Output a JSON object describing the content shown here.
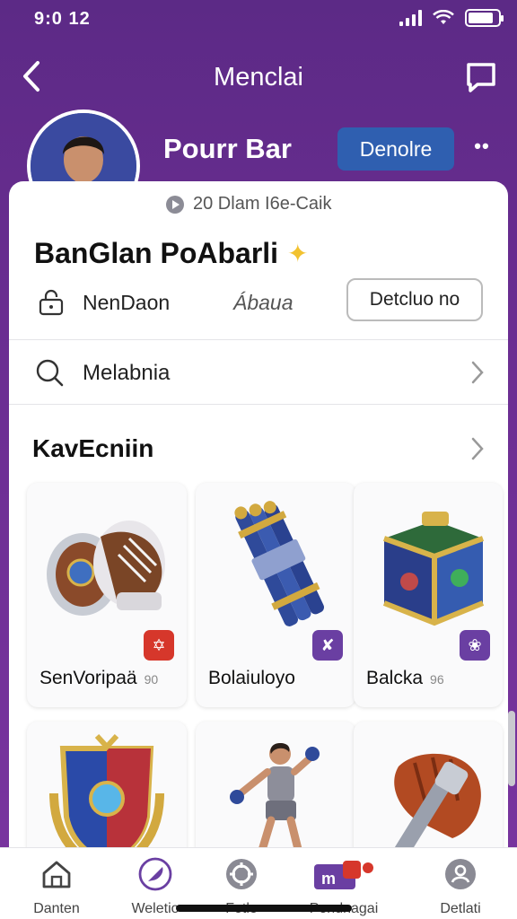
{
  "status_bar": {
    "time": "9:0 12"
  },
  "header": {
    "title": "Menclai"
  },
  "profile": {
    "name": "Pourr Bar",
    "primary_button": "Denolre",
    "meta": "20 Dlam I6e-Caik",
    "title": "BanGlan PoAbarli",
    "action_1": "NenDaon",
    "action_2": "Ábaua",
    "secondary_button": "Detcluo no"
  },
  "search": {
    "label": "Melabnia"
  },
  "section": {
    "title": "KavEcniin"
  },
  "items": [
    {
      "name": "SenVoripaä",
      "count": "90",
      "badge": "✡",
      "badge_color": "#d6372b",
      "icon": "gauntlets-icon"
    },
    {
      "name": "Bolaiuloyo",
      "count": "",
      "badge": "✘",
      "badge_color": "#6a3fa2",
      "icon": "rockets-bundle-icon"
    },
    {
      "name": "Balcka",
      "count": "96",
      "badge": "❀",
      "badge_color": "#6a3fa2",
      "icon": "treasure-chest-icon"
    },
    {
      "name": "",
      "count": "",
      "badge": "",
      "badge_color": "",
      "icon": "crest-shield-icon"
    },
    {
      "name": "",
      "count": "",
      "badge": "",
      "badge_color": "",
      "icon": "fighter-figure-icon"
    },
    {
      "name": "",
      "count": "",
      "badge": "",
      "badge_color": "",
      "icon": "glove-hammer-icon"
    }
  ],
  "bottom_nav": [
    {
      "label": "Danten",
      "icon": "home-icon"
    },
    {
      "label": "Weletio",
      "icon": "feather-icon"
    },
    {
      "label": "Fotle",
      "icon": "gear-flower-icon"
    },
    {
      "label": "Pendnagai",
      "icon": "messages-icon"
    },
    {
      "label": "Detlati",
      "icon": "profile-badge-icon"
    }
  ],
  "colors": {
    "brand_purple": "#6a2d91",
    "primary_blue": "#2f5fb0",
    "badge_red": "#d6372b"
  }
}
